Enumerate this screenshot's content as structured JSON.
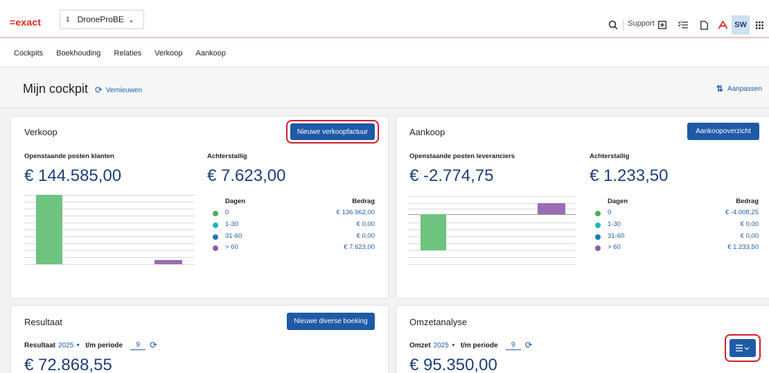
{
  "header": {
    "logo": "=exact",
    "company_number": "1",
    "company_name": "DroneProBE",
    "support_label": "Support",
    "user_initials": "SW",
    "icons": [
      "search-icon",
      "add-box-icon",
      "checklist-icon",
      "document-icon",
      "acrobat-icon",
      "apps-grid-icon"
    ]
  },
  "nav": {
    "items": [
      {
        "label": "Cockpits"
      },
      {
        "label": "Boekhouding"
      },
      {
        "label": "Relaties"
      },
      {
        "label": "Verkoop"
      },
      {
        "label": "Aankoop"
      }
    ]
  },
  "page": {
    "title": "Mijn cockpit",
    "refresh_label": "Vernieuwen",
    "customize_label": "Aanpassen"
  },
  "verkoop": {
    "title": "Verkoop",
    "button": "Nieuwe verkoopfactuur",
    "open_label": "Openstaande posten klanten",
    "open_value": "€ 144.585,00",
    "overdue_label": "Achterstallig",
    "overdue_value": "€ 7.623,00",
    "aging_head_days": "Dagen",
    "aging_head_amount": "Bedrag",
    "aging": [
      {
        "days": "0",
        "amount": "€ 136.962,00",
        "color": "#4caf50"
      },
      {
        "days": "1-30",
        "amount": "€ 0,00",
        "color": "#26b4b0"
      },
      {
        "days": "31-60",
        "amount": "€ 0,00",
        "color": "#1f78c1"
      },
      {
        "days": "> 60",
        "amount": "€ 7.623,00",
        "color": "#8e5ca7"
      }
    ]
  },
  "aankoop": {
    "title": "Aankoop",
    "button": "Aankoopoverzicht",
    "open_label": "Openstaande posten leveranciers",
    "open_value": "€ -2.774,75",
    "overdue_label": "Achterstallig",
    "overdue_value": "€ 1.233,50",
    "aging_head_days": "Dagen",
    "aging_head_amount": "Bedrag",
    "aging": [
      {
        "days": "0",
        "amount": "€ -4.008,25",
        "color": "#4caf50"
      },
      {
        "days": "1-30",
        "amount": "€ 0,00",
        "color": "#26b4b0"
      },
      {
        "days": "31-60",
        "amount": "€ 0,00",
        "color": "#1f78c1"
      },
      {
        "days": "> 60",
        "amount": "€ 1.233,50",
        "color": "#8e5ca7"
      }
    ]
  },
  "resultaat": {
    "title": "Resultaat",
    "button": "Nieuwe diverse boeking",
    "filter_label": "Resultaat",
    "year": "2025",
    "tm_label": "t/m periode",
    "period": "9",
    "value": "€ 72.868,55"
  },
  "omzet": {
    "title": "Omzetanalyse",
    "filter_label": "Omzet",
    "year": "2025",
    "tm_label": "t/m periode",
    "period": "9",
    "value": "€ 95.350,00"
  },
  "colors": {
    "accent": "#1f5aa6",
    "brand_red": "#e1251b",
    "highlight": "#d21d28",
    "bar_green": "#6ec37f",
    "bar_purple": "#9b6bb3"
  }
}
